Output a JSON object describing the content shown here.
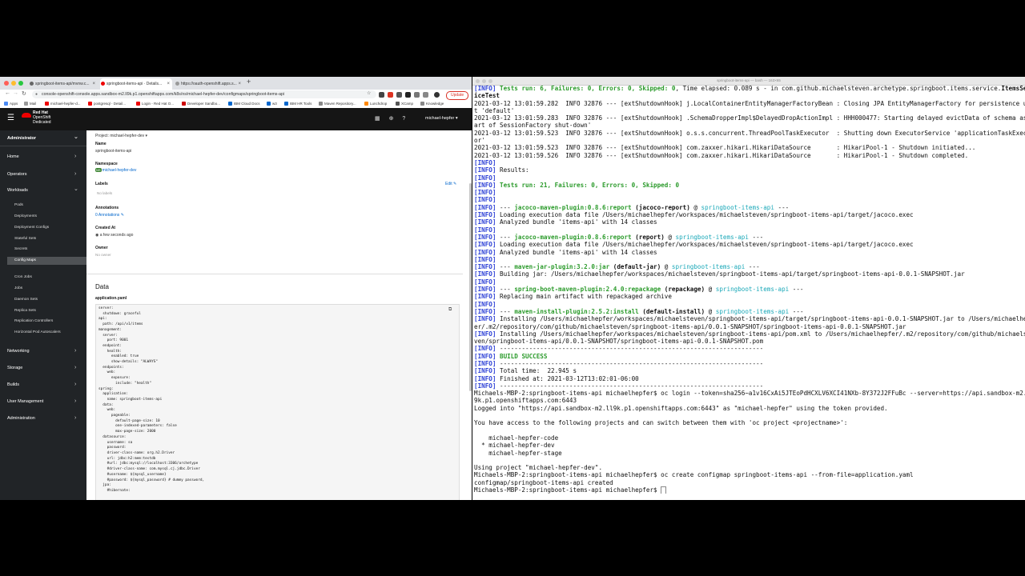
{
  "browser": {
    "tabs": [
      {
        "label": "springboot-items-api/mvnw.c..."
      },
      {
        "label": "springboot-items-api · Details..."
      },
      {
        "label": "https://oauth-openshift.apps.s..."
      }
    ],
    "url": "console-openshift-console.apps.sandbox-m2.ll9k.p1.openshiftapps.com/k8s/ns/michael-hepfer-dev/configmaps/springboot-items-api",
    "update_label": "Update",
    "bookmarks": [
      "Apps",
      "Mail",
      "michael-hepfer-d...",
      "postgresql - Detail...",
      "Login - Red Hat O...",
      "Developer Sandbo...",
      "IBM Cloud Docs",
      "w3",
      "IBM HR Tools",
      "Maven Repository...",
      "Lunchdrop",
      "XCamp",
      "Knowledge"
    ]
  },
  "console": {
    "brand": [
      "Red Hat",
      "OpenShift",
      "Dedicated"
    ],
    "user": "michael-hepfer",
    "sidebar": {
      "perspective": "Administrator",
      "home": "Home",
      "operators": "Operators",
      "workloads": "Workloads",
      "workload_items": [
        "Pods",
        "Deployments",
        "Deployment Configs",
        "Stateful Sets",
        "Secrets",
        "Config Maps",
        "Cron Jobs",
        "Jobs",
        "Daemon Sets",
        "Replica Sets",
        "Replication Controllers",
        "Horizontal Pod Autoscalers"
      ],
      "networking": "Networking",
      "storage": "Storage",
      "builds": "Builds",
      "user_management": "User Management",
      "administration": "Administration"
    },
    "project_label": "Project: michael-hepfer-dev",
    "details": {
      "name_label": "Name",
      "name_value": "springboot-items-api",
      "namespace_label": "Namespace",
      "namespace_badge": "NS",
      "namespace_value": "michael-hepfer-dev",
      "labels_label": "Labels",
      "labels_edit": "Edit",
      "labels_value": "No labels",
      "annotations_label": "Annotations",
      "annotations_value": "0 Annotations",
      "created_label": "Created At",
      "created_value": "a few seconds ago",
      "owner_label": "Owner",
      "owner_value": "No owner"
    },
    "data_heading": "Data",
    "data_key": "application.yaml",
    "yaml": "server:\n  shutdown: graceful\napi:\n  path: /api/v1/items\nmanagement:\n  server:\n    port: 9001\n  endpoint:\n    health:\n      enabled: true\n      show-details: \"ALWAYS\"\n  endpoints:\n    web:\n      exposure:\n        include: \"health\"\nspring:\n  application:\n    name: springboot-items-api\n  data:\n    web:\n      pageable:\n        default-page-size: 10\n        one-indexed-parameters: false\n        max-page-size: 2000\n  datasource:\n    username: sa\n    password:\n    driver-class-name: org.h2.Driver\n    url: jdbc:h2:mem:testdb\n    #url: jdbc:mysql://localhost:3306/archetype\n    #driver-class-name: com.mysql.cj.jdbc.Driver\n    #username: ${mysql_username}\n    #password: ${mysql_password} # dummy password,\n  jpa:\n    #hibernate:"
  },
  "terminal": {
    "title": "springboot-items-api — bash — 163×65",
    "lines": [
      [
        {
          "t": "[INFO] ",
          "c": "ib"
        },
        {
          "t": "Tests run: 6, Failures: 0, Errors: 0, Skipped: 0",
          "c": "grn"
        },
        {
          "t": ", Time elapsed: 0.089 s - in com.github.michaelsteven.archetype.springboot.items.service."
        },
        {
          "t": "ItemsServ",
          "c": "b"
        }
      ],
      [
        {
          "t": "iceTest",
          "c": "b"
        }
      ],
      [
        {
          "t": "2021-03-12 13:01:59.282  INFO 32876 --- [extShutdownHook] j.LocalContainerEntityManagerFactoryBean : Closing JPA EntityManagerFactory for persistence uni"
        }
      ],
      [
        {
          "t": "t 'default'"
        }
      ],
      [
        {
          "t": "2021-03-12 13:01:59.283  INFO 32876 --- [extShutdownHook] .SchemaDropperImpl$DelayedDropActionImpl : HHH000477: Starting delayed evictData of schema as p"
        }
      ],
      [
        {
          "t": "art of SessionFactory shut-down'"
        }
      ],
      [
        {
          "t": "2021-03-12 13:01:59.523  INFO 32876 --- [extShutdownHook] o.s.s.concurrent.ThreadPoolTaskExecutor  : Shutting down ExecutorService 'applicationTaskExecut"
        }
      ],
      [
        {
          "t": "or'"
        }
      ],
      [
        {
          "t": "2021-03-12 13:01:59.523  INFO 32876 --- [extShutdownHook] com.zaxxer.hikari.HikariDataSource       : HikariPool-1 - Shutdown initiated..."
        }
      ],
      [
        {
          "t": "2021-03-12 13:01:59.526  INFO 32876 --- [extShutdownHook] com.zaxxer.hikari.HikariDataSource       : HikariPool-1 - Shutdown completed."
        }
      ],
      [
        {
          "t": "[INFO]",
          "c": "ib"
        }
      ],
      [
        {
          "t": "[INFO] ",
          "c": "ib"
        },
        {
          "t": "Results:"
        }
      ],
      [
        {
          "t": "[INFO]",
          "c": "ib"
        }
      ],
      [
        {
          "t": "[INFO] ",
          "c": "ib"
        },
        {
          "t": "Tests run: 21, Failures: 0, Errors: 0, Skipped: 0",
          "c": "grn"
        }
      ],
      [
        {
          "t": "[INFO]",
          "c": "ib"
        }
      ],
      [
        {
          "t": "[INFO]",
          "c": "ib"
        }
      ],
      [
        {
          "t": "[INFO] ",
          "c": "ib"
        },
        {
          "t": "--- "
        },
        {
          "t": "jacoco-maven-plugin:0.8.6:report",
          "c": "grn"
        },
        {
          "t": " "
        },
        {
          "t": "(jacoco-report)",
          "c": "b"
        },
        {
          "t": " @ "
        },
        {
          "t": "springboot-items-api",
          "c": "cyn"
        },
        {
          "t": " ---"
        }
      ],
      [
        {
          "t": "[INFO] ",
          "c": "ib"
        },
        {
          "t": "Loading execution data file /Users/michaelhepfer/workspaces/michaelsteven/springboot-items-api/target/jacoco.exec"
        }
      ],
      [
        {
          "t": "[INFO] ",
          "c": "ib"
        },
        {
          "t": "Analyzed bundle 'items-api' with 14 classes"
        }
      ],
      [
        {
          "t": "[INFO]",
          "c": "ib"
        }
      ],
      [
        {
          "t": "[INFO] ",
          "c": "ib"
        },
        {
          "t": "--- "
        },
        {
          "t": "jacoco-maven-plugin:0.8.6:report",
          "c": "grn"
        },
        {
          "t": " "
        },
        {
          "t": "(report)",
          "c": "b"
        },
        {
          "t": " @ "
        },
        {
          "t": "springboot-items-api",
          "c": "cyn"
        },
        {
          "t": " ---"
        }
      ],
      [
        {
          "t": "[INFO] ",
          "c": "ib"
        },
        {
          "t": "Loading execution data file /Users/michaelhepfer/workspaces/michaelsteven/springboot-items-api/target/jacoco.exec"
        }
      ],
      [
        {
          "t": "[INFO] ",
          "c": "ib"
        },
        {
          "t": "Analyzed bundle 'items-api' with 14 classes"
        }
      ],
      [
        {
          "t": "[INFO]",
          "c": "ib"
        }
      ],
      [
        {
          "t": "[INFO] ",
          "c": "ib"
        },
        {
          "t": "--- "
        },
        {
          "t": "maven-jar-plugin:3.2.0:jar",
          "c": "grn"
        },
        {
          "t": " "
        },
        {
          "t": "(default-jar)",
          "c": "b"
        },
        {
          "t": " @ "
        },
        {
          "t": "springboot-items-api",
          "c": "cyn"
        },
        {
          "t": " ---"
        }
      ],
      [
        {
          "t": "[INFO] ",
          "c": "ib"
        },
        {
          "t": "Building jar: /Users/michaelhepfer/workspaces/michaelsteven/springboot-items-api/target/springboot-items-api-0.0.1-SNAPSHOT.jar"
        }
      ],
      [
        {
          "t": "[INFO]",
          "c": "ib"
        }
      ],
      [
        {
          "t": "[INFO] ",
          "c": "ib"
        },
        {
          "t": "--- "
        },
        {
          "t": "spring-boot-maven-plugin:2.4.0:repackage",
          "c": "grn"
        },
        {
          "t": " "
        },
        {
          "t": "(repackage)",
          "c": "b"
        },
        {
          "t": " @ "
        },
        {
          "t": "springboot-items-api",
          "c": "cyn"
        },
        {
          "t": " ---"
        }
      ],
      [
        {
          "t": "[INFO] ",
          "c": "ib"
        },
        {
          "t": "Replacing main artifact with repackaged archive"
        }
      ],
      [
        {
          "t": "[INFO]",
          "c": "ib"
        }
      ],
      [
        {
          "t": "[INFO] ",
          "c": "ib"
        },
        {
          "t": "--- "
        },
        {
          "t": "maven-install-plugin:2.5.2:install",
          "c": "grn"
        },
        {
          "t": " "
        },
        {
          "t": "(default-install)",
          "c": "b"
        },
        {
          "t": " @ "
        },
        {
          "t": "springboot-items-api",
          "c": "cyn"
        },
        {
          "t": " ---"
        }
      ],
      [
        {
          "t": "[INFO] ",
          "c": "ib"
        },
        {
          "t": "Installing /Users/michaelhepfer/workspaces/michaelsteven/springboot-items-api/target/springboot-items-api-0.0.1-SNAPSHOT.jar to /Users/michaelhepf"
        }
      ],
      [
        {
          "t": "er/.m2/repository/com/github/michaelsteven/springboot-items-api/0.0.1-SNAPSHOT/springboot-items-api-0.0.1-SNAPSHOT.jar"
        }
      ],
      [
        {
          "t": "[INFO] ",
          "c": "ib"
        },
        {
          "t": "Installing /Users/michaelhepfer/workspaces/michaelsteven/springboot-items-api/pom.xml to /Users/michaelhepfer/.m2/repository/com/github/michaelste"
        }
      ],
      [
        {
          "t": "ven/springboot-items-api/0.0.1-SNAPSHOT/springboot-items-api-0.0.1-SNAPSHOT.pom"
        }
      ],
      [
        {
          "t": "[INFO] ",
          "c": "ib"
        },
        {
          "t": "------------------------------------------------------------------------"
        }
      ],
      [
        {
          "t": "[INFO] ",
          "c": "ib"
        },
        {
          "t": "BUILD SUCCESS",
          "c": "grn"
        }
      ],
      [
        {
          "t": "[INFO] ",
          "c": "ib"
        },
        {
          "t": "------------------------------------------------------------------------"
        }
      ],
      [
        {
          "t": "[INFO] ",
          "c": "ib"
        },
        {
          "t": "Total time:  22.945 s"
        }
      ],
      [
        {
          "t": "[INFO] ",
          "c": "ib"
        },
        {
          "t": "Finished at: 2021-03-12T13:02:01-06:00"
        }
      ],
      [
        {
          "t": "[INFO] ",
          "c": "ib"
        },
        {
          "t": "------------------------------------------------------------------------"
        }
      ],
      [
        {
          "t": "Michaels-MBP-2:springboot-items-api michaelhepfer$ oc login --token=sha256~a1v16CxAi5JTEoPdHCXLV6XCI41NXb-8Y372J2FFuBc --server=https://api.sandbox-m2.ll"
        }
      ],
      [
        {
          "t": "9k.p1.openshiftapps.com:6443"
        }
      ],
      [
        {
          "t": "Logged into \"https://api.sandbox-m2.ll9k.p1.openshiftapps.com:6443\" as \"michael-hepfer\" using the token provided."
        }
      ],
      [
        {
          "t": ""
        }
      ],
      [
        {
          "t": "You have access to the following projects and can switch between them with 'oc project <projectname>':"
        }
      ],
      [
        {
          "t": ""
        }
      ],
      [
        {
          "t": "    michael-hepfer-code"
        }
      ],
      [
        {
          "t": "  * michael-hepfer-dev"
        }
      ],
      [
        {
          "t": "    michael-hepfer-stage"
        }
      ],
      [
        {
          "t": ""
        }
      ],
      [
        {
          "t": "Using project \"michael-hepfer-dev\"."
        }
      ],
      [
        {
          "t": "Michaels-MBP-2:springboot-items-api michaelhepfer$ oc create configmap springboot-items-api --from-file=application.yaml"
        }
      ],
      [
        {
          "t": "configmap/springboot-items-api created"
        }
      ],
      [
        {
          "t": "Michaels-MBP-2:springboot-items-api michaelhepfer$ "
        }
      ]
    ]
  }
}
